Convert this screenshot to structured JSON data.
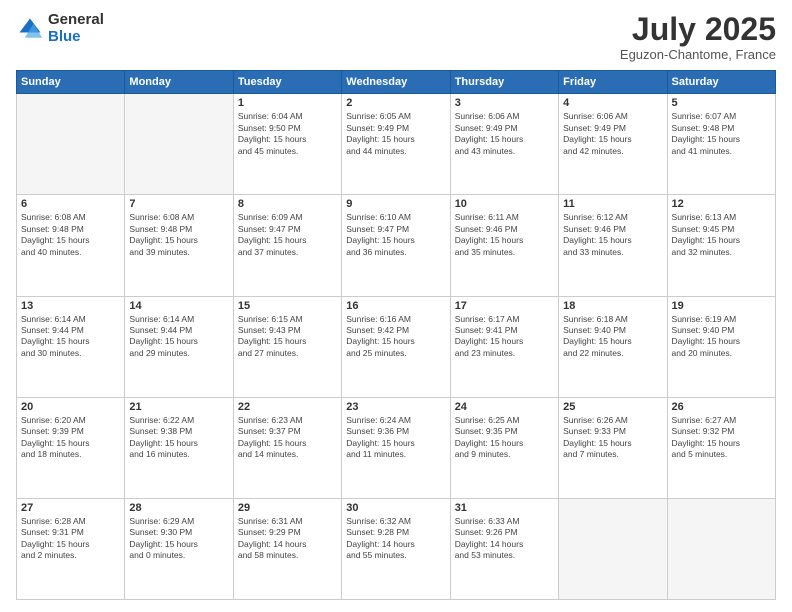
{
  "header": {
    "logo_general": "General",
    "logo_blue": "Blue",
    "month_title": "July 2025",
    "location": "Eguzon-Chantome, France"
  },
  "weekdays": [
    "Sunday",
    "Monday",
    "Tuesday",
    "Wednesday",
    "Thursday",
    "Friday",
    "Saturday"
  ],
  "weeks": [
    [
      {
        "day": "",
        "info": ""
      },
      {
        "day": "",
        "info": ""
      },
      {
        "day": "1",
        "info": "Sunrise: 6:04 AM\nSunset: 9:50 PM\nDaylight: 15 hours\nand 45 minutes."
      },
      {
        "day": "2",
        "info": "Sunrise: 6:05 AM\nSunset: 9:49 PM\nDaylight: 15 hours\nand 44 minutes."
      },
      {
        "day": "3",
        "info": "Sunrise: 6:06 AM\nSunset: 9:49 PM\nDaylight: 15 hours\nand 43 minutes."
      },
      {
        "day": "4",
        "info": "Sunrise: 6:06 AM\nSunset: 9:49 PM\nDaylight: 15 hours\nand 42 minutes."
      },
      {
        "day": "5",
        "info": "Sunrise: 6:07 AM\nSunset: 9:48 PM\nDaylight: 15 hours\nand 41 minutes."
      }
    ],
    [
      {
        "day": "6",
        "info": "Sunrise: 6:08 AM\nSunset: 9:48 PM\nDaylight: 15 hours\nand 40 minutes."
      },
      {
        "day": "7",
        "info": "Sunrise: 6:08 AM\nSunset: 9:48 PM\nDaylight: 15 hours\nand 39 minutes."
      },
      {
        "day": "8",
        "info": "Sunrise: 6:09 AM\nSunset: 9:47 PM\nDaylight: 15 hours\nand 37 minutes."
      },
      {
        "day": "9",
        "info": "Sunrise: 6:10 AM\nSunset: 9:47 PM\nDaylight: 15 hours\nand 36 minutes."
      },
      {
        "day": "10",
        "info": "Sunrise: 6:11 AM\nSunset: 9:46 PM\nDaylight: 15 hours\nand 35 minutes."
      },
      {
        "day": "11",
        "info": "Sunrise: 6:12 AM\nSunset: 9:46 PM\nDaylight: 15 hours\nand 33 minutes."
      },
      {
        "day": "12",
        "info": "Sunrise: 6:13 AM\nSunset: 9:45 PM\nDaylight: 15 hours\nand 32 minutes."
      }
    ],
    [
      {
        "day": "13",
        "info": "Sunrise: 6:14 AM\nSunset: 9:44 PM\nDaylight: 15 hours\nand 30 minutes."
      },
      {
        "day": "14",
        "info": "Sunrise: 6:14 AM\nSunset: 9:44 PM\nDaylight: 15 hours\nand 29 minutes."
      },
      {
        "day": "15",
        "info": "Sunrise: 6:15 AM\nSunset: 9:43 PM\nDaylight: 15 hours\nand 27 minutes."
      },
      {
        "day": "16",
        "info": "Sunrise: 6:16 AM\nSunset: 9:42 PM\nDaylight: 15 hours\nand 25 minutes."
      },
      {
        "day": "17",
        "info": "Sunrise: 6:17 AM\nSunset: 9:41 PM\nDaylight: 15 hours\nand 23 minutes."
      },
      {
        "day": "18",
        "info": "Sunrise: 6:18 AM\nSunset: 9:40 PM\nDaylight: 15 hours\nand 22 minutes."
      },
      {
        "day": "19",
        "info": "Sunrise: 6:19 AM\nSunset: 9:40 PM\nDaylight: 15 hours\nand 20 minutes."
      }
    ],
    [
      {
        "day": "20",
        "info": "Sunrise: 6:20 AM\nSunset: 9:39 PM\nDaylight: 15 hours\nand 18 minutes."
      },
      {
        "day": "21",
        "info": "Sunrise: 6:22 AM\nSunset: 9:38 PM\nDaylight: 15 hours\nand 16 minutes."
      },
      {
        "day": "22",
        "info": "Sunrise: 6:23 AM\nSunset: 9:37 PM\nDaylight: 15 hours\nand 14 minutes."
      },
      {
        "day": "23",
        "info": "Sunrise: 6:24 AM\nSunset: 9:36 PM\nDaylight: 15 hours\nand 11 minutes."
      },
      {
        "day": "24",
        "info": "Sunrise: 6:25 AM\nSunset: 9:35 PM\nDaylight: 15 hours\nand 9 minutes."
      },
      {
        "day": "25",
        "info": "Sunrise: 6:26 AM\nSunset: 9:33 PM\nDaylight: 15 hours\nand 7 minutes."
      },
      {
        "day": "26",
        "info": "Sunrise: 6:27 AM\nSunset: 9:32 PM\nDaylight: 15 hours\nand 5 minutes."
      }
    ],
    [
      {
        "day": "27",
        "info": "Sunrise: 6:28 AM\nSunset: 9:31 PM\nDaylight: 15 hours\nand 2 minutes."
      },
      {
        "day": "28",
        "info": "Sunrise: 6:29 AM\nSunset: 9:30 PM\nDaylight: 15 hours\nand 0 minutes."
      },
      {
        "day": "29",
        "info": "Sunrise: 6:31 AM\nSunset: 9:29 PM\nDaylight: 14 hours\nand 58 minutes."
      },
      {
        "day": "30",
        "info": "Sunrise: 6:32 AM\nSunset: 9:28 PM\nDaylight: 14 hours\nand 55 minutes."
      },
      {
        "day": "31",
        "info": "Sunrise: 6:33 AM\nSunset: 9:26 PM\nDaylight: 14 hours\nand 53 minutes."
      },
      {
        "day": "",
        "info": ""
      },
      {
        "day": "",
        "info": ""
      }
    ]
  ]
}
